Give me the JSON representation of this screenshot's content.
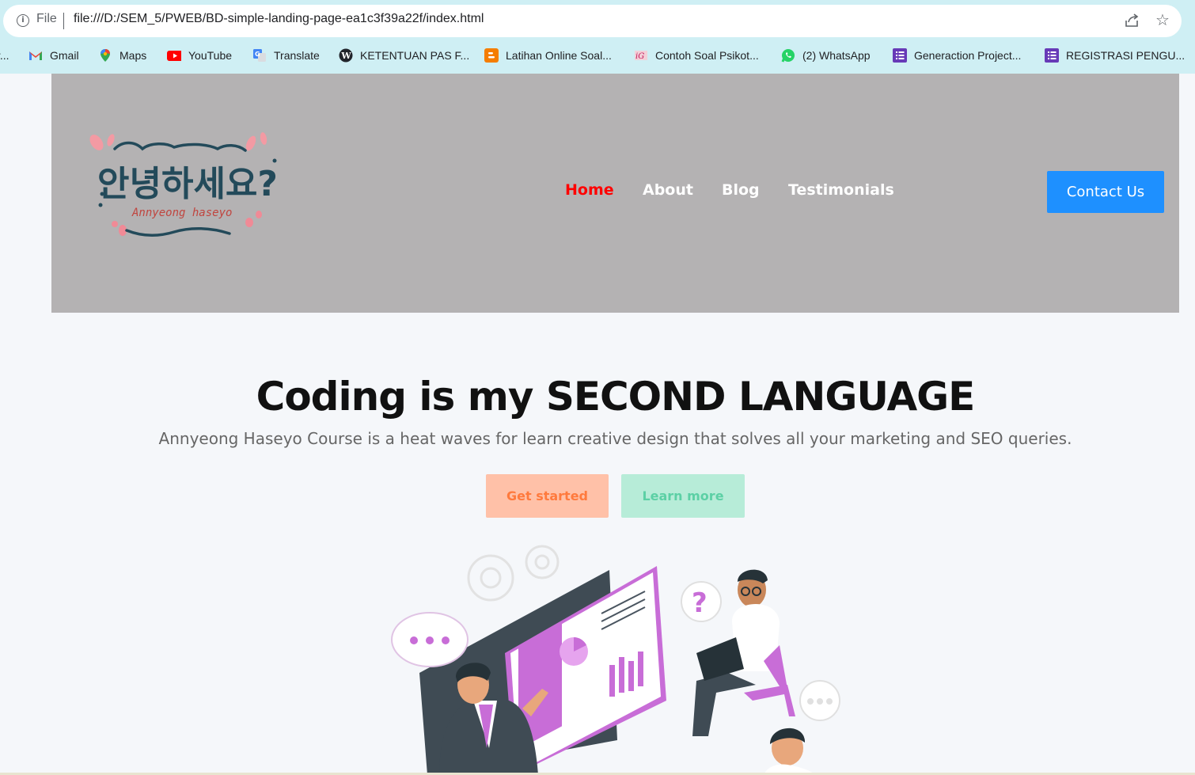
{
  "browser": {
    "url_scheme_label": "File",
    "url": "file:///D:/SEM_5/PWEB/BD-simple-landing-page-ea1c3f39a22f/index.html",
    "bookmarks": [
      {
        "label": "r...",
        "icon": "bookmark-icon"
      },
      {
        "label": "Gmail",
        "icon": "gmail-icon"
      },
      {
        "label": "Maps",
        "icon": "maps-icon"
      },
      {
        "label": "YouTube",
        "icon": "youtube-icon"
      },
      {
        "label": "Translate",
        "icon": "translate-icon"
      },
      {
        "label": "KETENTUAN PAS F...",
        "icon": "wordpress-icon"
      },
      {
        "label": "Latihan Online Soal...",
        "icon": "blogger-icon"
      },
      {
        "label": "Contoh Soal Psikot...",
        "icon": "site-icon"
      },
      {
        "label": "(2) WhatsApp",
        "icon": "whatsapp-icon"
      },
      {
        "label": "Generaction Project...",
        "icon": "forms-icon"
      },
      {
        "label": "REGISTRASI PENGU...",
        "icon": "forms-icon"
      }
    ]
  },
  "header": {
    "logo": {
      "korean": "안녕하세요?",
      "latin": "Annyeong haseyo"
    },
    "nav": [
      {
        "label": "Home",
        "active": true
      },
      {
        "label": "About",
        "active": false
      },
      {
        "label": "Blog",
        "active": false
      },
      {
        "label": "Testimonials",
        "active": false
      }
    ],
    "cta": "Contact Us"
  },
  "hero": {
    "title": "Coding is my SECOND LANGUAGE",
    "subtitle": "Annyeong Haseyo Course is a heat waves for learn creative design that solves all your marketing and SEO queries.",
    "primary_button": "Get started",
    "secondary_button": "Learn more"
  },
  "colors": {
    "header_bg": "#b4b2b3",
    "nav_active": "#ff0000",
    "cta_bg": "#1e90ff",
    "primary_btn_bg": "#ffc1a8",
    "primary_btn_text": "#ff7a3d",
    "secondary_btn_bg": "#b7ecd8",
    "secondary_btn_text": "#5cd0a5",
    "accent_purple": "#c86dd7"
  }
}
